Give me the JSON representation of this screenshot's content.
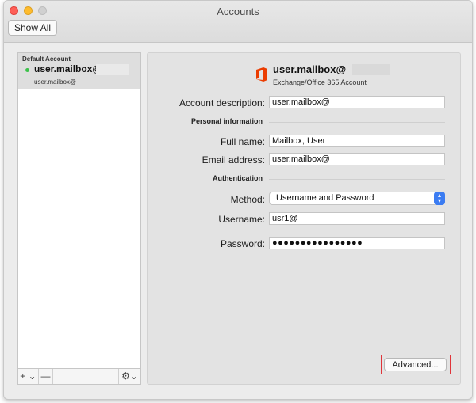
{
  "window": {
    "title": "Accounts",
    "show_all_label": "Show All"
  },
  "sidebar": {
    "section_header": "Default Account",
    "account_name": "user.mailbox@",
    "account_email": "user.mailbox@",
    "status_color": "#3cc24a",
    "add_label": "+ ⌄",
    "remove_label": "—",
    "gear_label": "⚙⌄"
  },
  "account": {
    "display_name": "user.mailbox@",
    "account_type": "Exchange/Office 365 Account",
    "icon": "office-365-icon",
    "description_label": "Account description:",
    "description_value": "user.mailbox@",
    "personal_section": "Personal information",
    "full_name_label": "Full name:",
    "full_name_value": "Mailbox, User",
    "email_label": "Email address:",
    "email_value": "user.mailbox@",
    "auth_section": "Authentication",
    "method_label": "Method:",
    "method_value": "Username and Password",
    "username_label": "Username:",
    "username_value": "usr1@",
    "password_label": "Password:",
    "password_value": "●●●●●●●●●●●●●●●●",
    "advanced_label": "Advanced..."
  },
  "colors": {
    "highlight": "#e0343a",
    "select_accent": "#3b7cf2"
  }
}
